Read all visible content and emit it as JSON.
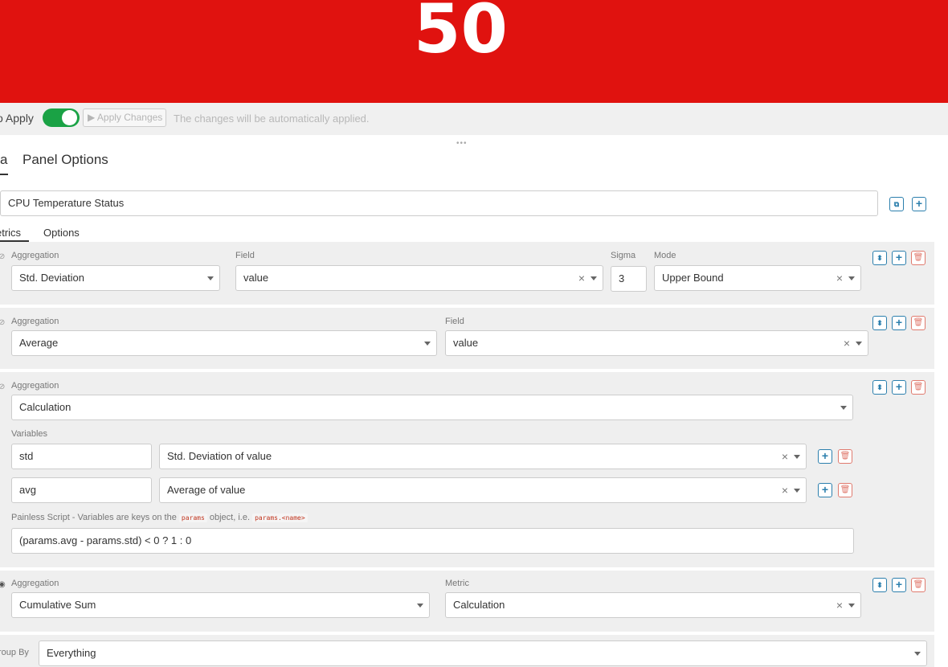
{
  "banner": {
    "value": "50",
    "color": "#e0120f"
  },
  "apply_bar": {
    "auto_apply_label": "o Apply",
    "toggle_on": true,
    "apply_button": "▶ Apply Changes",
    "note": "The changes will be automatically applied."
  },
  "tabs": [
    {
      "label": "a",
      "active": true
    },
    {
      "label": "Panel Options",
      "active": false
    }
  ],
  "series_label": {
    "value": "CPU Temperature Status"
  },
  "subtabs": [
    {
      "label": "etrics",
      "active": true
    },
    {
      "label": "Options",
      "active": false
    }
  ],
  "metrics": {
    "m1": {
      "aggregation_label": "Aggregation",
      "aggregation": "Std. Deviation",
      "field_label": "Field",
      "field": "value",
      "sigma_label": "Sigma",
      "sigma": "3",
      "mode_label": "Mode",
      "mode": "Upper Bound"
    },
    "m2": {
      "aggregation_label": "Aggregation",
      "aggregation": "Average",
      "field_label": "Field",
      "field": "value"
    },
    "m3": {
      "aggregation_label": "Aggregation",
      "aggregation": "Calculation",
      "variables_label": "Variables",
      "variables": [
        {
          "name": "std",
          "metric": "Std. Deviation of value"
        },
        {
          "name": "avg",
          "metric": "Average of value"
        }
      ],
      "script_hint_prefix": "Painless Script - Variables are keys on the",
      "script_hint_code1": "params",
      "script_hint_mid": "object, i.e.",
      "script_hint_code2": "params.<name>",
      "script": "(params.avg - params.std) < 0 ? 1 : 0"
    },
    "m4": {
      "aggregation_label": "Aggregation",
      "aggregation": "Cumulative Sum",
      "metric_label": "Metric",
      "metric": "Calculation"
    }
  },
  "group_by": {
    "label": "roup By",
    "value": "Everything"
  },
  "icons": {
    "move": "sort-icon",
    "add": "plus-icon",
    "delete": "trash-icon",
    "clone": "clone-icon",
    "eye": "eye-icon"
  }
}
